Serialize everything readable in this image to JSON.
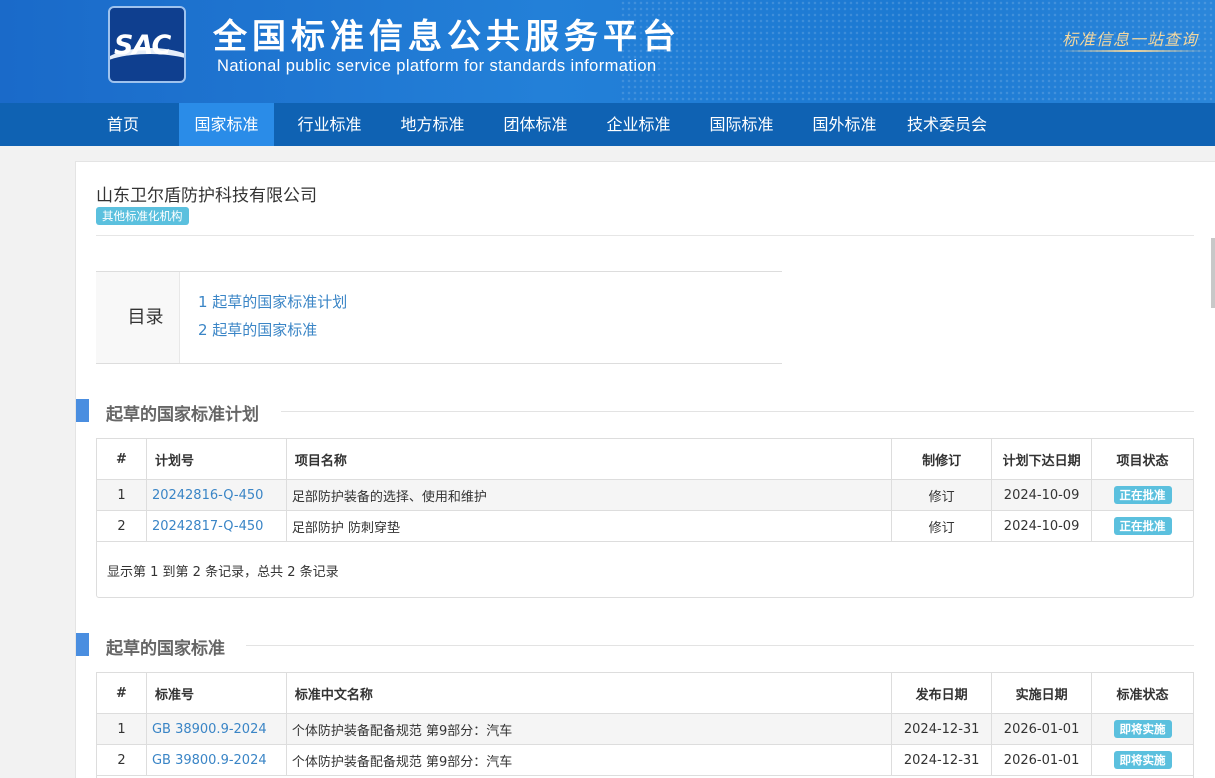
{
  "header": {
    "logo_text": "SAC",
    "title_cn": "全国标准信息公共服务平台",
    "title_en": "National public service platform  for standards information",
    "slogan": "标准信息一站查询"
  },
  "nav": [
    {
      "label": "首页",
      "active": false
    },
    {
      "label": "国家标准",
      "active": true
    },
    {
      "label": "行业标准",
      "active": false
    },
    {
      "label": "地方标准",
      "active": false
    },
    {
      "label": "团体标准",
      "active": false
    },
    {
      "label": "企业标准",
      "active": false
    },
    {
      "label": "国际标准",
      "active": false
    },
    {
      "label": "国外标准",
      "active": false
    },
    {
      "label": "技术委员会",
      "active": false
    }
  ],
  "org": {
    "name": "山东卫尔盾防护科技有限公司",
    "tag": "其他标准化机构"
  },
  "toc": {
    "label": "目录",
    "items": [
      "1  起草的国家标准计划",
      "2  起草的国家标准"
    ]
  },
  "plans": {
    "title": "起草的国家标准计划",
    "headers": [
      "#",
      "计划号",
      "项目名称",
      "制修订",
      "计划下达日期",
      "项目状态"
    ],
    "rows": [
      {
        "no": "1",
        "code": "20242816-Q-450",
        "name": "足部防护装备的选择、使用和维护",
        "type": "修订",
        "date": "2024-10-09",
        "status": "正在批准"
      },
      {
        "no": "2",
        "code": "20242817-Q-450",
        "name": "足部防护 防刺穿垫",
        "type": "修订",
        "date": "2024-10-09",
        "status": "正在批准"
      }
    ],
    "pager": "显示第 1 到第 2 条记录，总共 2 条记录"
  },
  "standards": {
    "title": "起草的国家标准",
    "headers": [
      "#",
      "标准号",
      "标准中文名称",
      "发布日期",
      "实施日期",
      "标准状态"
    ],
    "rows": [
      {
        "no": "1",
        "code": "GB 38900.9-2024",
        "name": "个体防护装备配备规范 第9部分：汽车",
        "pub": "2024-12-31",
        "impl": "2026-01-01",
        "status": "即将实施"
      },
      {
        "no": "2",
        "code": "GB 39800.9-2024",
        "name": "个体防护装备配备规范 第9部分：汽车",
        "pub": "2024-12-31",
        "impl": "2026-01-01",
        "status": "即将实施"
      }
    ]
  },
  "colors": {
    "brand_blue": "#1a6ac9",
    "nav_bg": "#0f62b3",
    "nav_active": "#2a8ce8",
    "badge": "#5bc0de",
    "link": "#3a85c6"
  }
}
